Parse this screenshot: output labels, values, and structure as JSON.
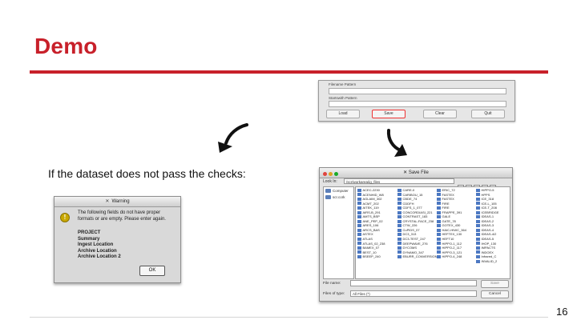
{
  "slide": {
    "title": "Demo",
    "caption": "If the dataset does not pass the checks:",
    "page_number": "16"
  },
  "colors": {
    "accent": "#c8202a"
  },
  "icons": {
    "arrow_left": "curved-arrow-down-left-icon",
    "arrow_right": "curved-arrow-down-right-icon"
  },
  "top_dialog": {
    "filename_pattern_label": "Filename Pattern",
    "startswith_pattern_label": "Startswith Pattern",
    "buttons": [
      "Load",
      "Save",
      "Clear",
      "Quit"
    ]
  },
  "warning": {
    "title": "Warning",
    "message": "The following fields do not have proper formats or are empty. Please enter again.",
    "fields": [
      "PROJECT",
      "Summary",
      "Ingest Location",
      "Archive Location",
      "Archive Location 2"
    ],
    "ok_label": "OK"
  },
  "save_dialog": {
    "title": "Save File",
    "look_in_label": "Look In:",
    "look_in_value": "/scr/workarea/ig_files",
    "places": [
      "Computer",
      "scr.cork"
    ],
    "columns": [
      [
        "ACEC-2230",
        "ACENHID_W8",
        "AGLAIM_302",
        "ACMT_202",
        "AITEK_119",
        "AIRS-B_291",
        "AMTS_BSP",
        "ANE_PEP_02",
        "ARES_106",
        "ARCS_BAS",
        "ASTEX",
        "ATLAS",
        "ATLAS_02_238",
        "BAMEX_07",
        "BEST_10",
        "BSEEP_240"
      ],
      [
        "CARE-0",
        "CARIBOU_15",
        "CBDE_74",
        "CDDFH",
        "CDFS_1_077",
        "CONCORDIASI_221",
        "CONTRAST_183",
        "CRYSTAL-FACE_238",
        "CTW_226",
        "CuPIDS_07",
        "DC3_313",
        "DC3-TEST_247",
        "DEEPWAVE_276",
        "DYCOMS",
        "DYNAMO_347",
        "EBURR_CONVERSION"
      ],
      [
        "ERIC_72",
        "FASTEX",
        "FASTEX",
        "FIRE",
        "FIRE",
        "FRAPPE_391",
        "GALE",
        "GATE_78",
        "GOTEX_430",
        "HAIC-HIWC_364",
        "HEFTEX_130",
        "HEFT10",
        "HIPPO-1_112",
        "HIPPO-2_117",
        "HIPPO-3_121",
        "HIPPO-4_248"
      ],
      [
        "HIPPO-5",
        "HPPS",
        "ICE_318",
        "ICE-L_105",
        "ICE-T_208",
        "ICEBRIDGE",
        "IDEAS-1",
        "IDEAS-2",
        "IDEAS-3",
        "IDEAS-4",
        "IDEAS-4/2",
        "IDEAS-5",
        "IHOP_130",
        "IMPACTS",
        "INDOEX",
        "Infrared_C",
        "INVALID_2"
      ]
    ],
    "file_name_label": "File name:",
    "file_name_value": "",
    "file_type_label": "Files of type:",
    "file_type_value": "All Files (*)",
    "save_label": "Save",
    "cancel_label": "Cancel"
  }
}
